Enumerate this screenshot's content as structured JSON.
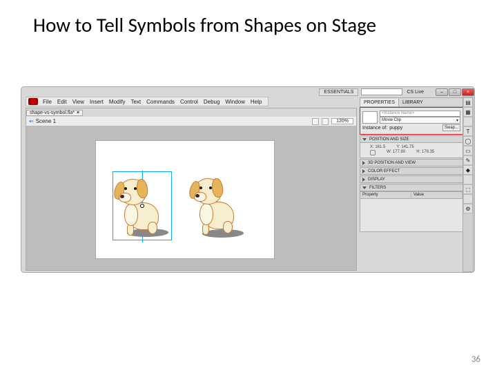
{
  "slide": {
    "title": "How to Tell Symbols from Shapes on Stage",
    "page": "36"
  },
  "titlebar": {
    "workspace": "ESSENTIALS",
    "cs": "CS Live"
  },
  "menu": [
    "File",
    "Edit",
    "View",
    "Insert",
    "Modify",
    "Text",
    "Commands",
    "Control",
    "Debug",
    "Window",
    "Help"
  ],
  "doc": {
    "tab": "shape-vs-symbol.fla*",
    "scene": "Scene 1",
    "zoom": "120%"
  },
  "panel": {
    "tabs": [
      "PROPERTIES",
      "LIBRARY"
    ],
    "instance_placeholder": "<Instance Name>",
    "type": "Movie Clip",
    "instance_of_label": "Instance of:",
    "instance_of": "puppy",
    "swap": "Swap...",
    "sections": {
      "position": "POSITION AND SIZE",
      "x": "X: 161.5",
      "y": "Y: 141.75",
      "w": "W: 177.80",
      "h": "H: 178.35",
      "s3d": "3D POSITION AND VIEW",
      "ce": "COLOR EFFECT",
      "disp": "DISPLAY",
      "filt": "FILTERS",
      "prop": "Property",
      "val": "Value"
    }
  },
  "righttools": [
    "▤",
    "▦",
    "",
    "T",
    "◯",
    "▭",
    "✎",
    "◆",
    "",
    "⬚",
    "",
    "⚙"
  ]
}
